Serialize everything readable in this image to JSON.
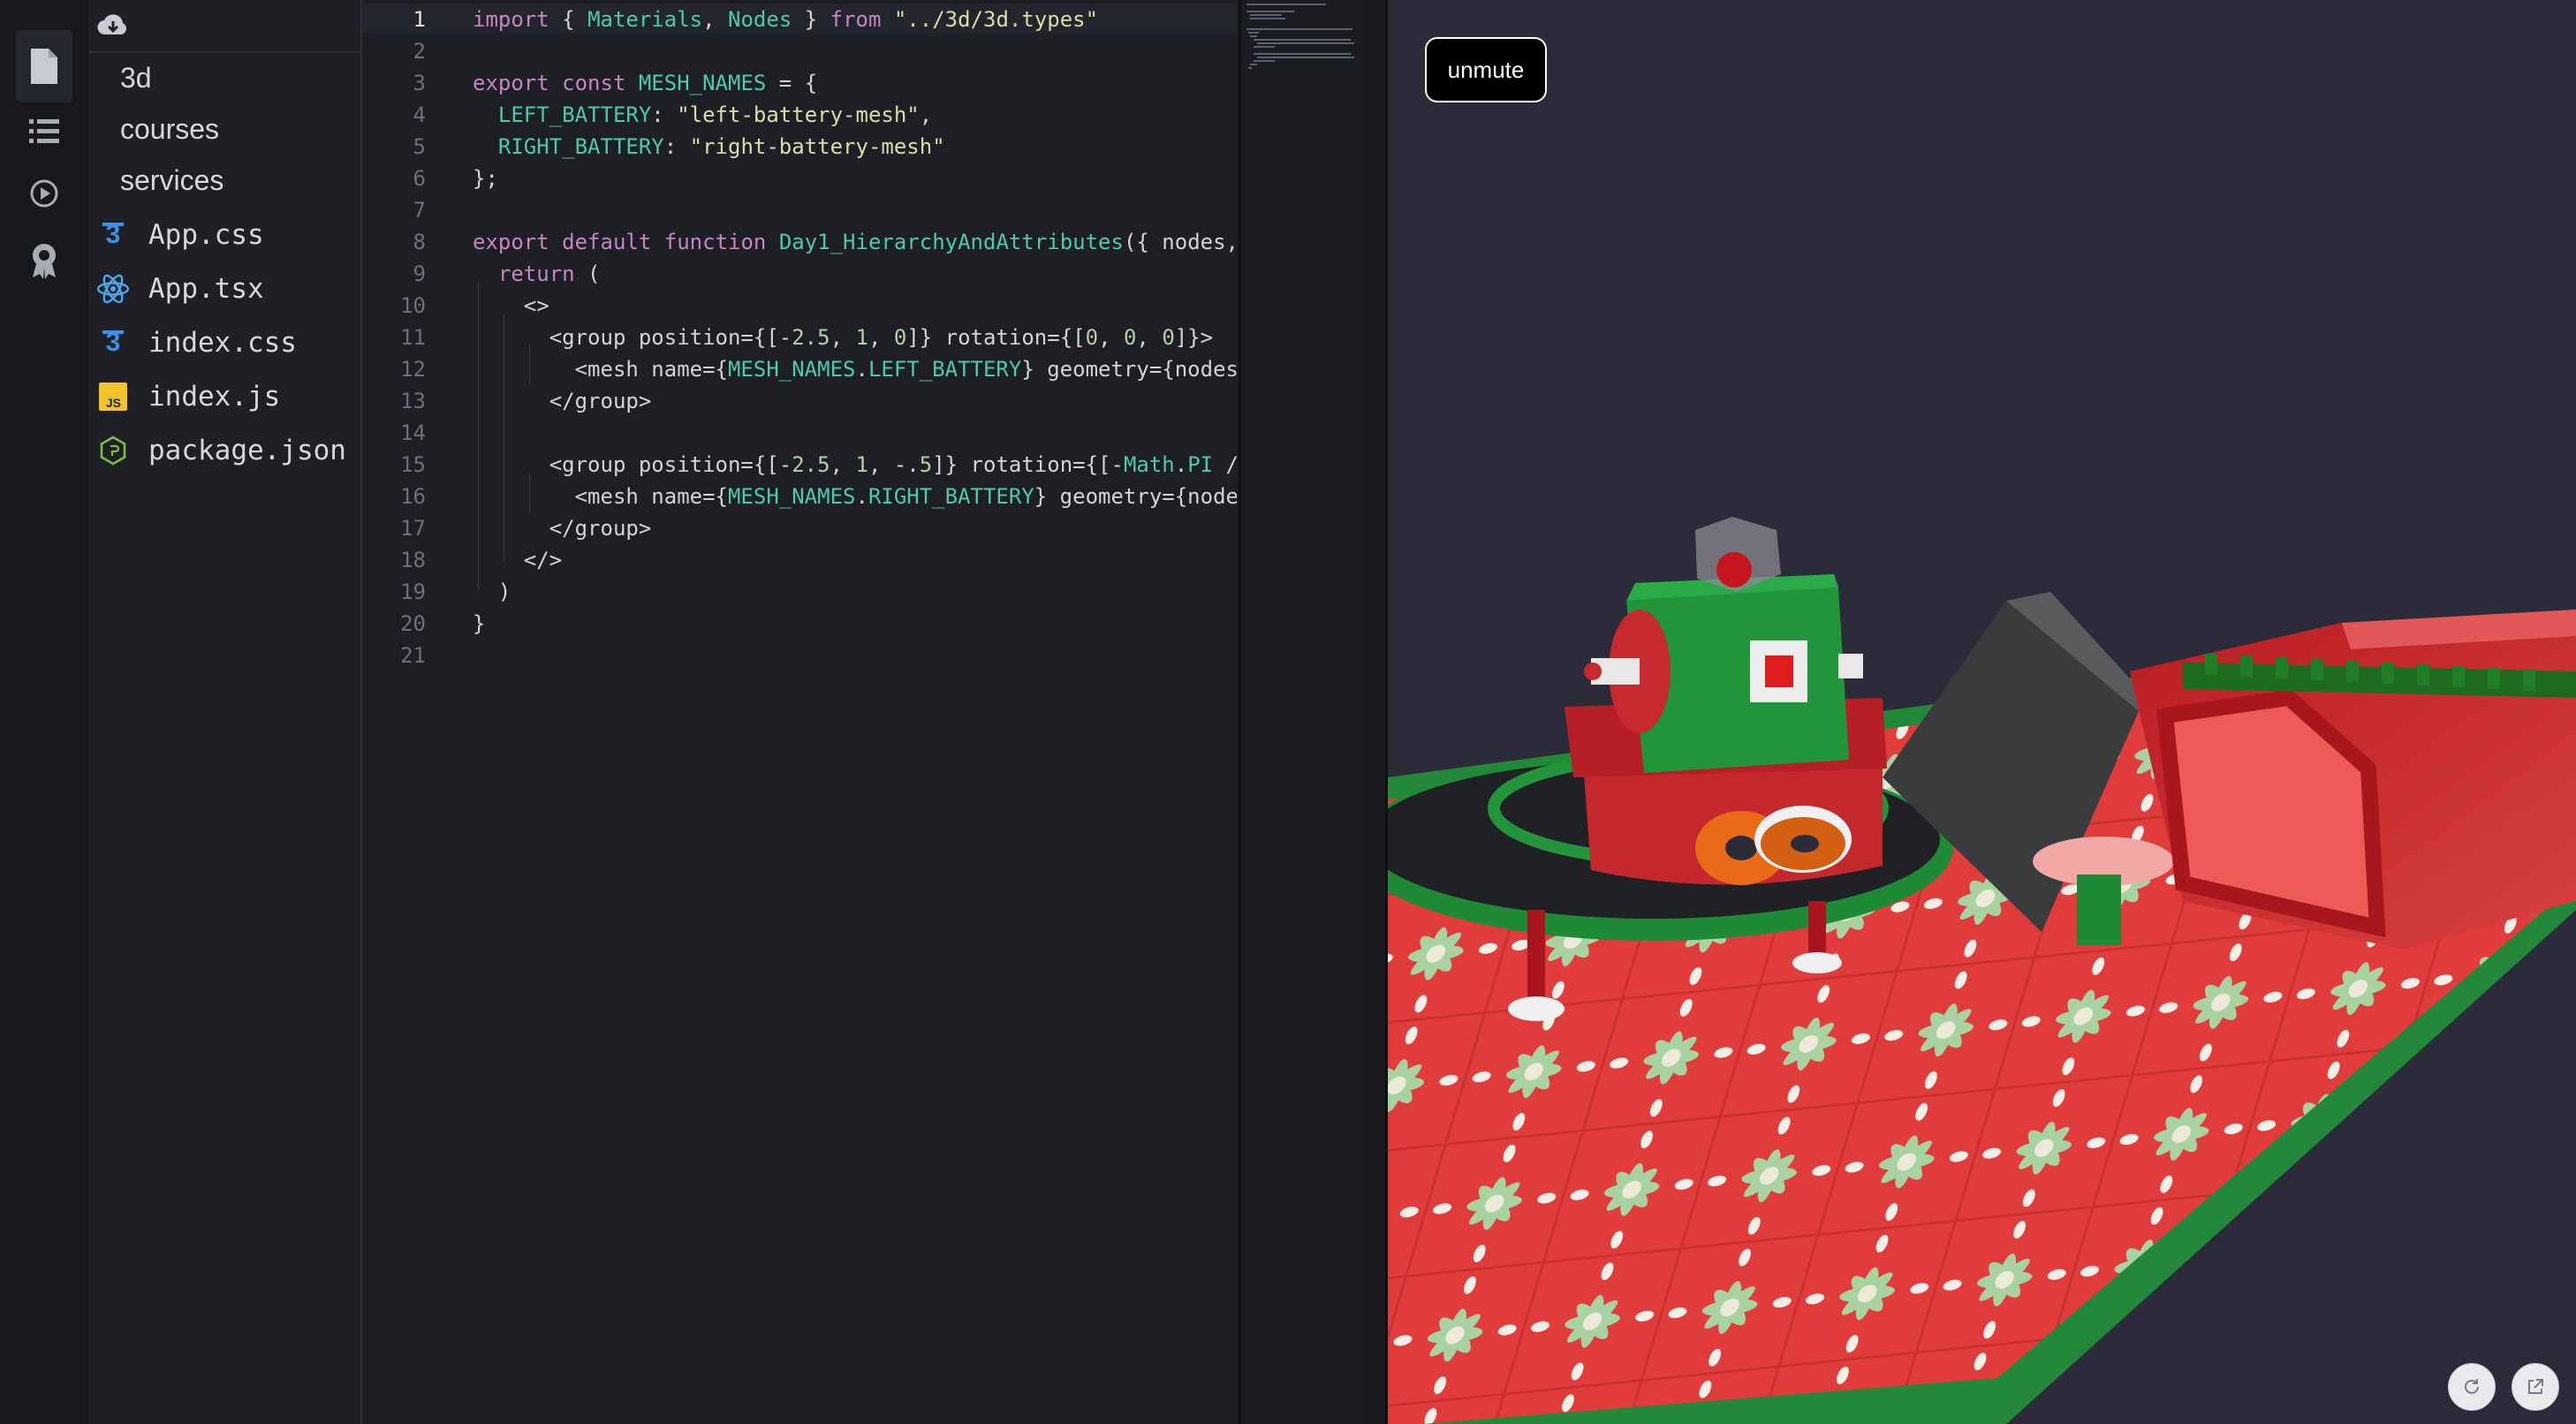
{
  "activity_bar": {
    "items": [
      "files-icon",
      "list-icon",
      "play-circle-icon",
      "badge-icon"
    ]
  },
  "sidebar": {
    "header_icon": "cloud-download-icon",
    "folders": [
      "3d",
      "courses",
      "services"
    ],
    "files": [
      {
        "name": "App.css",
        "icon": "css-icon"
      },
      {
        "name": "App.tsx",
        "icon": "react-icon"
      },
      {
        "name": "index.css",
        "icon": "css-icon"
      },
      {
        "name": "index.js",
        "icon": "js-icon"
      },
      {
        "name": "package.json",
        "icon": "node-icon"
      }
    ]
  },
  "editor": {
    "line_numbers": [
      "1",
      "2",
      "3",
      "4",
      "5",
      "6",
      "7",
      "8",
      "9",
      "10",
      "11",
      "12",
      "13",
      "14",
      "15",
      "16",
      "17",
      "18",
      "19",
      "20",
      "21"
    ],
    "active_line": "1",
    "lines": [
      "import { Materials, Nodes } from \"../3d/3d.types\"",
      "",
      "export const MESH_NAMES = {",
      "  LEFT_BATTERY: \"left-battery-mesh\",",
      "  RIGHT_BATTERY: \"right-battery-mesh\"",
      "};",
      "",
      "export default function Day1_HierarchyAndAttributes({ nodes,",
      "  return (",
      "    <>",
      "      <group position={[-2.5, 1, 0]} rotation={[0, 0, 0]}>",
      "        <mesh name={MESH_NAMES.LEFT_BATTERY} geometry={nodes",
      "      </group>",
      "",
      "      <group position={[-2.5, 1, -.5]} rotation={[-Math.PI /",
      "        <mesh name={MESH_NAMES.RIGHT_BATTERY} geometry={node",
      "      </group>",
      "    </>",
      "  )",
      "}",
      ""
    ]
  },
  "preview": {
    "unmute_label": "unmute",
    "refresh_icon": "refresh-icon",
    "open_external_icon": "external-link-icon"
  },
  "colors": {
    "keyword": "#c586c0",
    "identifier": "#4ec9b0",
    "string": "#dcdcaa",
    "number": "#b5cea8",
    "preview_bg": "#2c2b3a"
  }
}
